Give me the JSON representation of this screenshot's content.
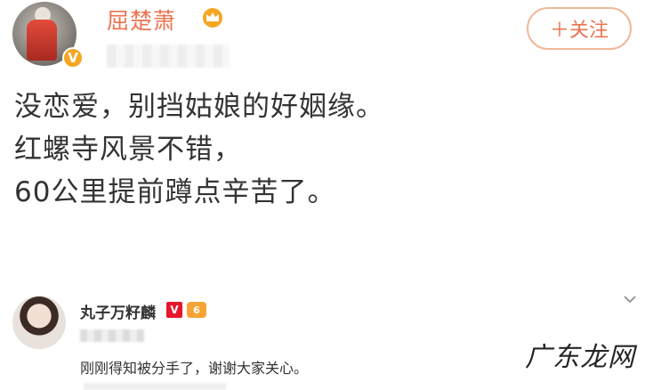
{
  "post": {
    "username": "屈楚萧",
    "follow_label": "＋关注",
    "lines": [
      "没恋爱，别挡姑娘的好姻缘。",
      "红螺寺风景不错，",
      "60公里提前蹲点辛苦了。"
    ],
    "verified_badge": "V"
  },
  "comment": {
    "username": "丸子万籽麟",
    "badge_v": "V",
    "badge_level": "6",
    "text": "刚刚得知被分手了，谢谢大家关心。"
  },
  "watermark": "广东龙网",
  "colors": {
    "accent": "#eb7350",
    "badge_red": "#e6162d",
    "badge_gold": "#f5a623"
  }
}
